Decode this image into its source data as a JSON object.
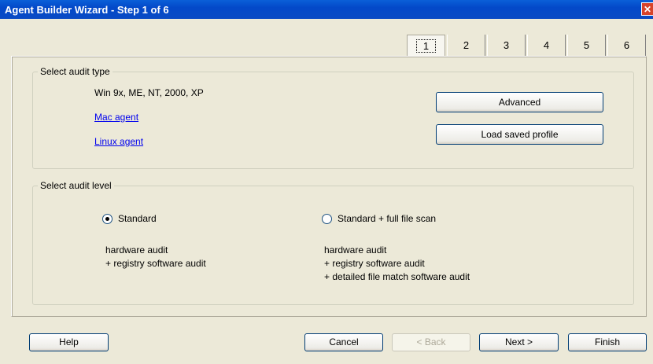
{
  "window": {
    "title": "Agent Builder Wizard - Step 1 of 6",
    "close_glyph": "✕"
  },
  "tabs": [
    {
      "label": "1",
      "active": true
    },
    {
      "label": "2",
      "active": false
    },
    {
      "label": "3",
      "active": false
    },
    {
      "label": "4",
      "active": false
    },
    {
      "label": "5",
      "active": false
    },
    {
      "label": "6",
      "active": false
    }
  ],
  "audit_type": {
    "legend": "Select audit type",
    "windows_label": "Win 9x, ME, NT, 2000, XP",
    "mac_link": "Mac agent",
    "linux_link": "Linux agent",
    "advanced_button": "Advanced",
    "load_profile_button": "Load saved profile"
  },
  "audit_level": {
    "legend": "Select audit level",
    "standard": {
      "label": "Standard",
      "checked": true,
      "desc_line1": "hardware audit",
      "desc_line2": "+ registry software audit"
    },
    "full_scan": {
      "label": "Standard + full file scan",
      "checked": false,
      "desc_line1": "hardware audit",
      "desc_line2": "+ registry software audit",
      "desc_line3": "+ detailed file match software audit"
    }
  },
  "footer": {
    "help": "Help",
    "cancel": "Cancel",
    "back": "< Back",
    "next": "Next >",
    "finish": "Finish"
  }
}
